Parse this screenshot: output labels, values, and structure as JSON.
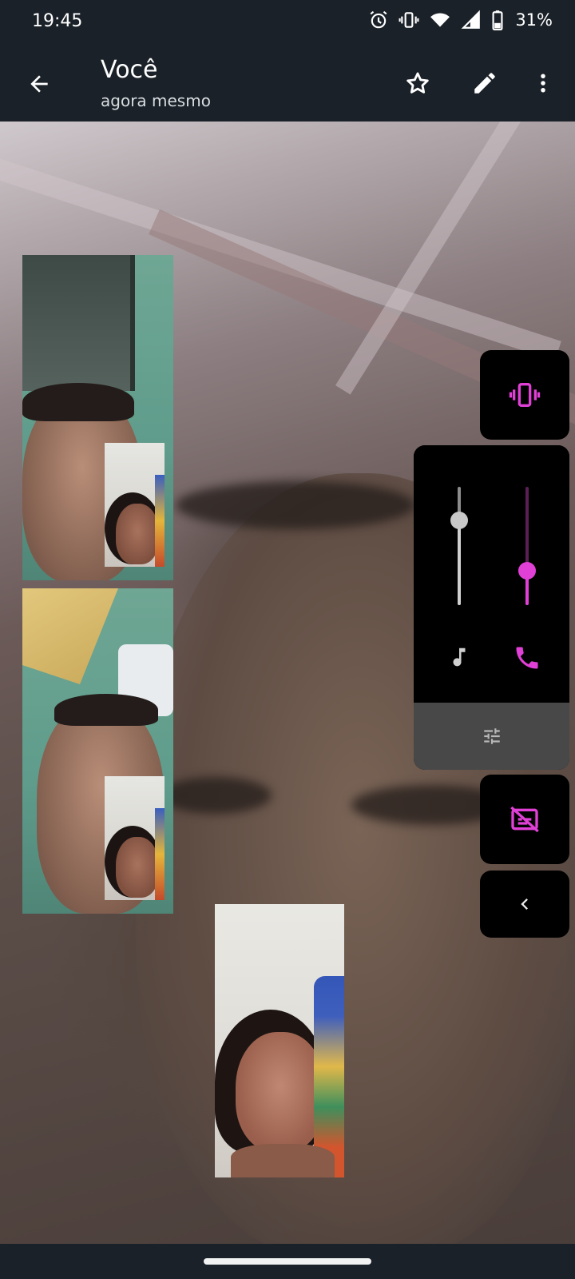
{
  "status_bar": {
    "time": "19:45",
    "battery": "31%",
    "icons": [
      "alarm-icon",
      "vibrate-icon",
      "wifi-icon",
      "signal-icon",
      "battery-icon"
    ]
  },
  "app_bar": {
    "title": "Você",
    "subtitle": "agora mesmo",
    "actions": [
      "star-icon",
      "edit-icon",
      "more-vert-icon"
    ]
  },
  "volume_panel": {
    "media_level": 0.75,
    "call_level": 0.29,
    "media_icon": "music-note-icon",
    "call_icon": "phone-icon",
    "settings_icon": "tune-icon",
    "ringer_icon": "vibrate-icon",
    "caption_icon": "captions-off-icon",
    "collapse_icon": "chevron-left-icon"
  },
  "colors": {
    "accent": "#e040d6",
    "bar": "#1a2128",
    "panel": "#000000",
    "panel_strip": "#484848"
  }
}
